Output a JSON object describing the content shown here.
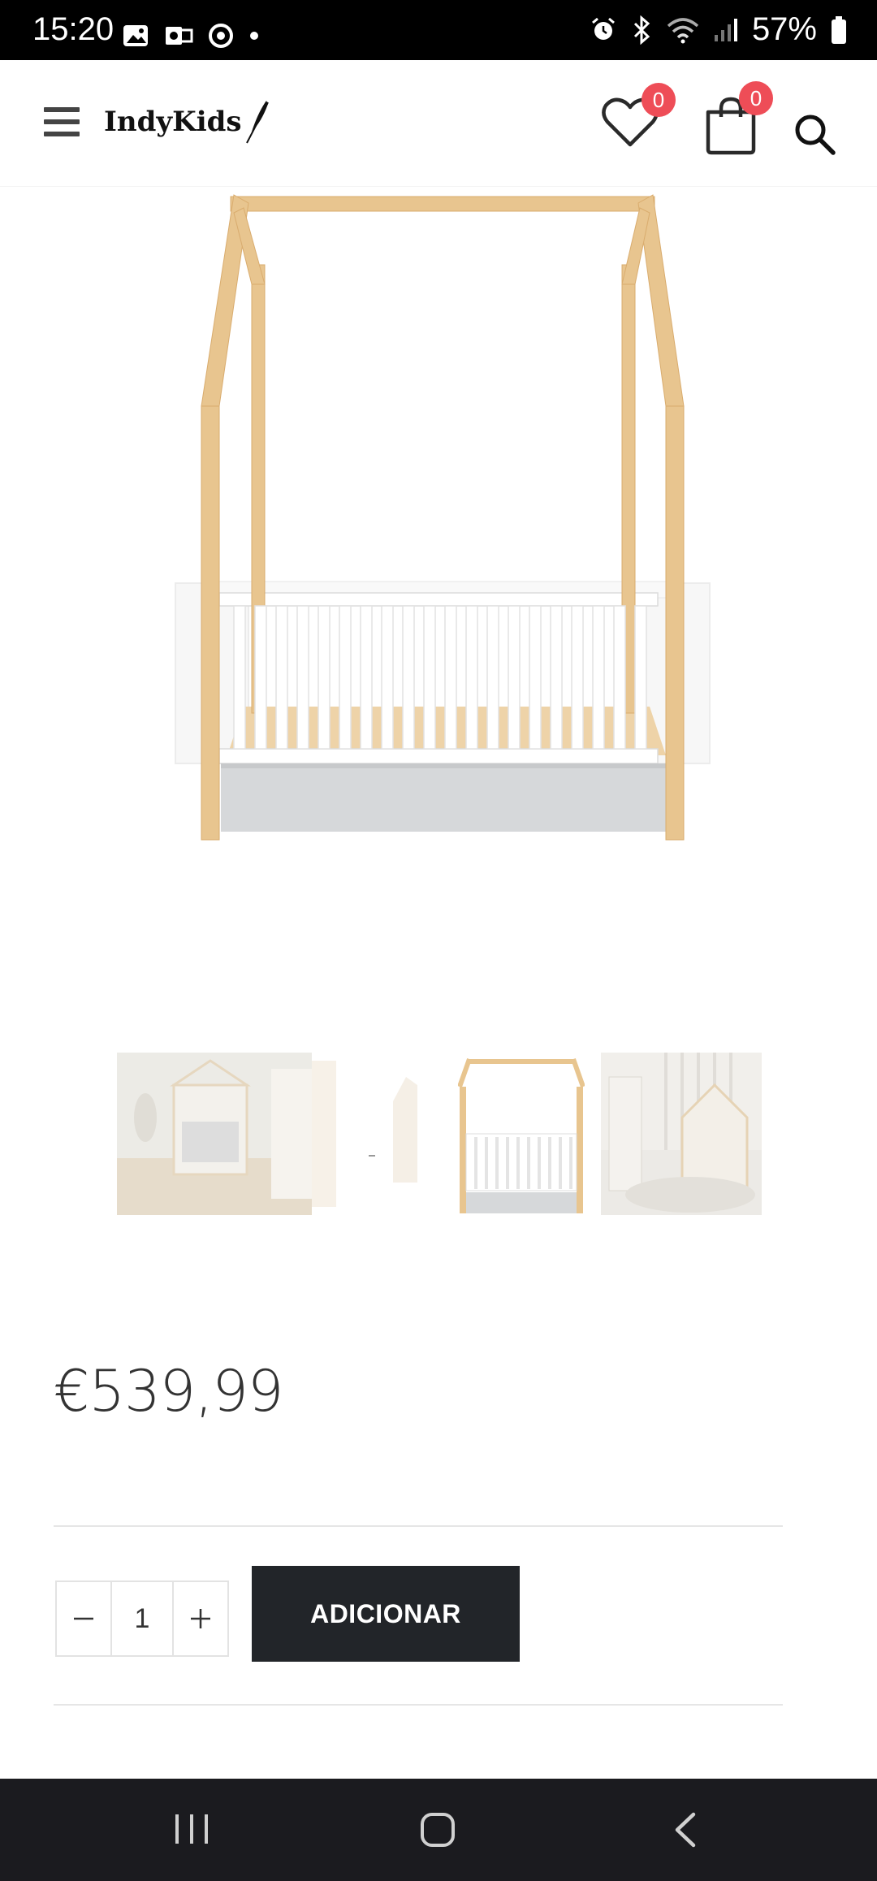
{
  "status_bar": {
    "time": "15:20",
    "battery": "57%",
    "left_icons": [
      "gallery-icon",
      "outlook-icon",
      "chrome-icon",
      "dot-icon"
    ],
    "right_icons": [
      "alarm-icon",
      "bluetooth-icon",
      "wifi-icon",
      "signal-icon",
      "battery-icon"
    ]
  },
  "header": {
    "logo_text": "IndyKids",
    "wishlist_count": "0",
    "cart_count": "0"
  },
  "product": {
    "price": "€539,99",
    "quantity": "1",
    "add_to_cart_label": "ADICIONAR",
    "thumbnail_count": 4
  },
  "colors": {
    "accent_badge": "#ee4d57",
    "button_dark": "#222529",
    "wood": "#e6c08c",
    "nav_bar": "#1b1b1f"
  }
}
